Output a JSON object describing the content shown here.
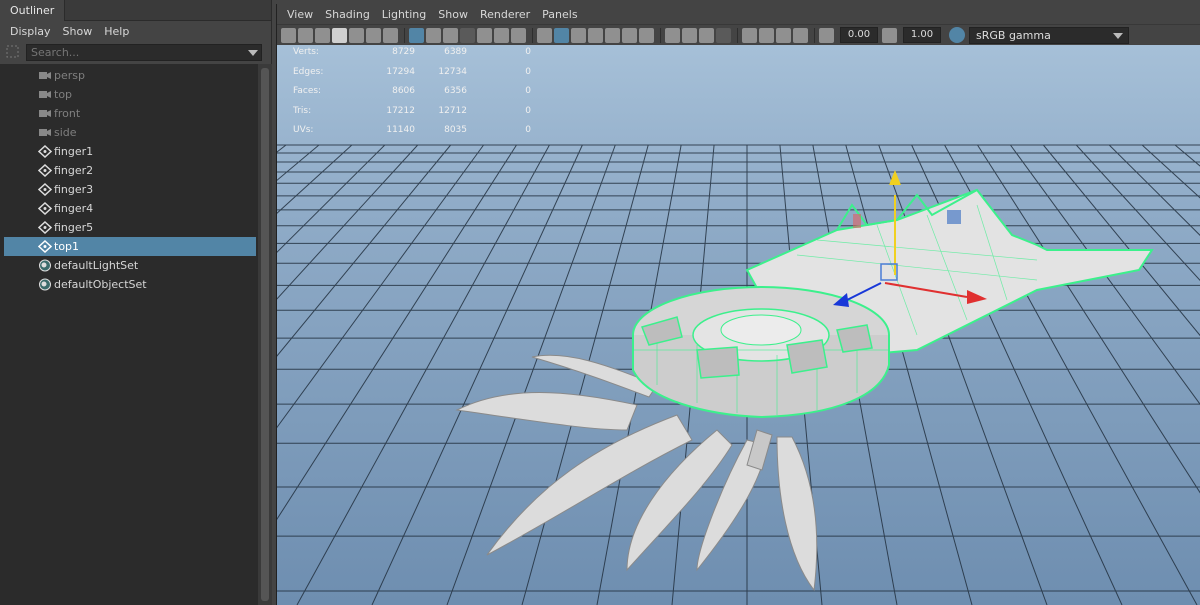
{
  "outliner": {
    "tab": "Outliner",
    "menu": [
      "Display",
      "Show",
      "Help"
    ],
    "search_placeholder": "Search...",
    "items": [
      {
        "label": "persp",
        "icon": "camera-icon",
        "dim": true
      },
      {
        "label": "top",
        "icon": "camera-icon",
        "dim": true
      },
      {
        "label": "front",
        "icon": "camera-icon",
        "dim": true
      },
      {
        "label": "side",
        "icon": "camera-icon",
        "dim": true
      },
      {
        "label": "finger1",
        "icon": "transform-icon",
        "dim": false
      },
      {
        "label": "finger2",
        "icon": "transform-icon",
        "dim": false
      },
      {
        "label": "finger3",
        "icon": "transform-icon",
        "dim": false
      },
      {
        "label": "finger4",
        "icon": "transform-icon",
        "dim": false
      },
      {
        "label": "finger5",
        "icon": "transform-icon",
        "dim": false
      },
      {
        "label": "top1",
        "icon": "transform-icon",
        "dim": false,
        "selected": true
      },
      {
        "label": "defaultLightSet",
        "icon": "set-icon",
        "dim": false
      },
      {
        "label": "defaultObjectSet",
        "icon": "set-icon",
        "dim": false
      }
    ]
  },
  "viewport": {
    "menu": [
      "View",
      "Shading",
      "Lighting",
      "Show",
      "Renderer",
      "Panels"
    ],
    "exposure": "0.00",
    "gamma": "1.00",
    "color_space": "sRGB gamma",
    "hud": [
      {
        "label": "Verts:",
        "a": "8729",
        "b": "6389",
        "c": "0"
      },
      {
        "label": "Edges:",
        "a": "17294",
        "b": "12734",
        "c": "0"
      },
      {
        "label": "Faces:",
        "a": "8606",
        "b": "6356",
        "c": "0"
      },
      {
        "label": "Tris:",
        "a": "17212",
        "b": "12712",
        "c": "0"
      },
      {
        "label": "UVs:",
        "a": "11140",
        "b": "8035",
        "c": "0"
      }
    ]
  },
  "colors": {
    "selection": "#5285a6",
    "panel": "#444444",
    "wire_highlight": "#3cf08c",
    "grid": "#1e2a38",
    "manip_x": "#e03030",
    "manip_y": "#f0d020",
    "manip_z": "#1838d8"
  }
}
